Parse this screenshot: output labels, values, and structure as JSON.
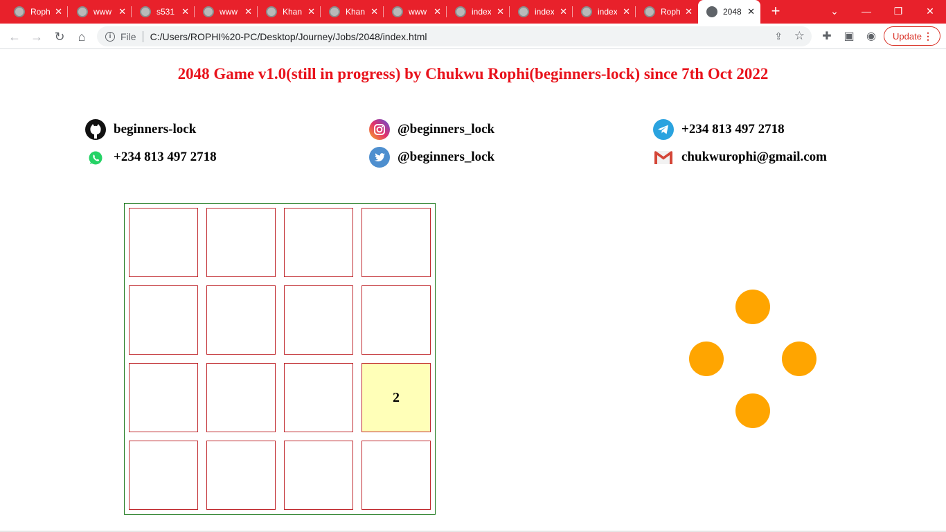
{
  "browser": {
    "tabs": [
      {
        "label": "Roph"
      },
      {
        "label": "www"
      },
      {
        "label": "s531"
      },
      {
        "label": "www"
      },
      {
        "label": "Khan"
      },
      {
        "label": "Khan"
      },
      {
        "label": "www"
      },
      {
        "label": "index"
      },
      {
        "label": "index"
      },
      {
        "label": "index"
      },
      {
        "label": "Roph"
      },
      {
        "label": "2048"
      }
    ],
    "file_label": "File",
    "url": "C:/Users/ROPHI%20-PC/Desktop/Journey/Jobs/2048/index.html",
    "update_label": "Update"
  },
  "page": {
    "title": "2048 Game v1.0(still in progress) by Chukwu Rophi(beginners-lock) since 7th Oct 2022",
    "contacts": {
      "github": "beginners-lock",
      "instagram": "@beginners_lock",
      "telegram": "+234 813 497 2718",
      "whatsapp": "+234 813 497 2718",
      "twitter": "@beginners_lock",
      "email": "chukwurophi@gmail.com"
    },
    "board": {
      "cells": [
        "",
        "",
        "",
        "",
        "",
        "",
        "",
        "",
        "",
        "",
        "",
        "2",
        "",
        "",
        "",
        ""
      ]
    },
    "colors": {
      "title": "#e8121b",
      "tile_filled": "#ffffb8",
      "control": "#ffa500"
    }
  }
}
